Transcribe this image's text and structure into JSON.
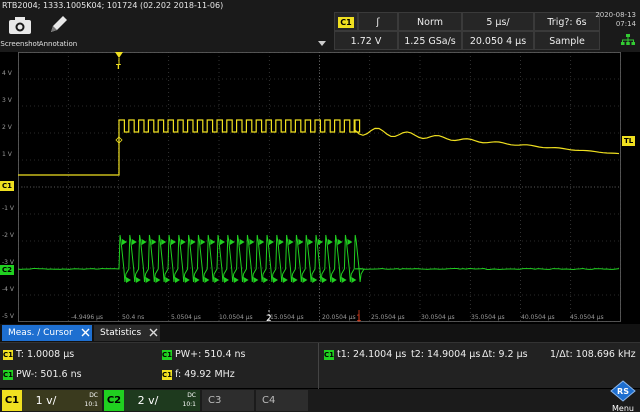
{
  "header": {
    "instrument_info": "RTB2004; 1333.1005K04; 101724 (02.202 2018-11-06)",
    "tools": [
      {
        "label": "Screenshot",
        "icon": "camera-icon"
      },
      {
        "label": "Annotation",
        "icon": "pencil-icon"
      }
    ],
    "trigger": {
      "source_badge": "C1",
      "slope_symbol": "ʃ",
      "mode": "Norm",
      "level": "1.72 V"
    },
    "timebase": {
      "scale": "5 µs/",
      "sample_rate": "1.25 GSa/s",
      "position": "20.050 4 µs"
    },
    "acquisition": {
      "trig_label": "Trig?: 6s",
      "mode": "Sample"
    },
    "datetime": {
      "date": "2020-08-13",
      "time": "07:14"
    },
    "colors": {
      "ch1": "#f0e020",
      "ch2": "#20d020",
      "accent": "#1e6fd0"
    }
  },
  "axes": {
    "y_labels": [
      "4 V",
      "3 V",
      "2 V",
      "1 V",
      "-1 V",
      "-2 V",
      "-3 V",
      "-4 V",
      "-5 V"
    ],
    "x_labels": [
      "-4.9496 µs",
      "50.4 ns",
      "5.0504 µs",
      "10.0504 µs",
      "15.0504 µs",
      "20.0504 µs",
      "25.0504 µs",
      "30.0504 µs",
      "35.0504 µs",
      "40.0504 µs",
      "45.0504 µs"
    ],
    "ch1_marker": "C1",
    "ch2_marker": "C2",
    "trigger_level_marker": "TL",
    "trigger_pos_marker": "T",
    "cursor1": "2",
    "cursor2": "1"
  },
  "measurements": {
    "tabs": [
      "Meas. / Cursor",
      "Statistics"
    ],
    "items": [
      {
        "badge": "C1",
        "text": "T: 1.0008 µs"
      },
      {
        "badge": "C1",
        "text": "PW+: 510.4 ns"
      },
      {
        "badge": "C1",
        "text": "PW-: 501.6 ns"
      },
      {
        "badge": "C1",
        "text": "f: 49.92 MHz"
      }
    ],
    "cursor": {
      "badge": "C1",
      "t1": "t1: 24.1004 µs",
      "t2": "t2: 14.9004 µs",
      "dt": "Δt: 9.2 µs",
      "inv_dt": "1/Δt: 108.696 kHz"
    }
  },
  "channels": [
    {
      "name": "C1",
      "scale": "1 v/",
      "coupling": "DC",
      "state": "10:1",
      "color": "#f0e020"
    },
    {
      "name": "C2",
      "scale": "2 v/",
      "coupling": "DC",
      "state": "10:1",
      "color": "#20d020"
    },
    {
      "name": "C3",
      "scale": "",
      "coupling": "",
      "state": "",
      "color": "#555555"
    },
    {
      "name": "C4",
      "scale": "",
      "coupling": "",
      "state": "",
      "color": "#555555"
    }
  ],
  "menu_label": "Menu"
}
